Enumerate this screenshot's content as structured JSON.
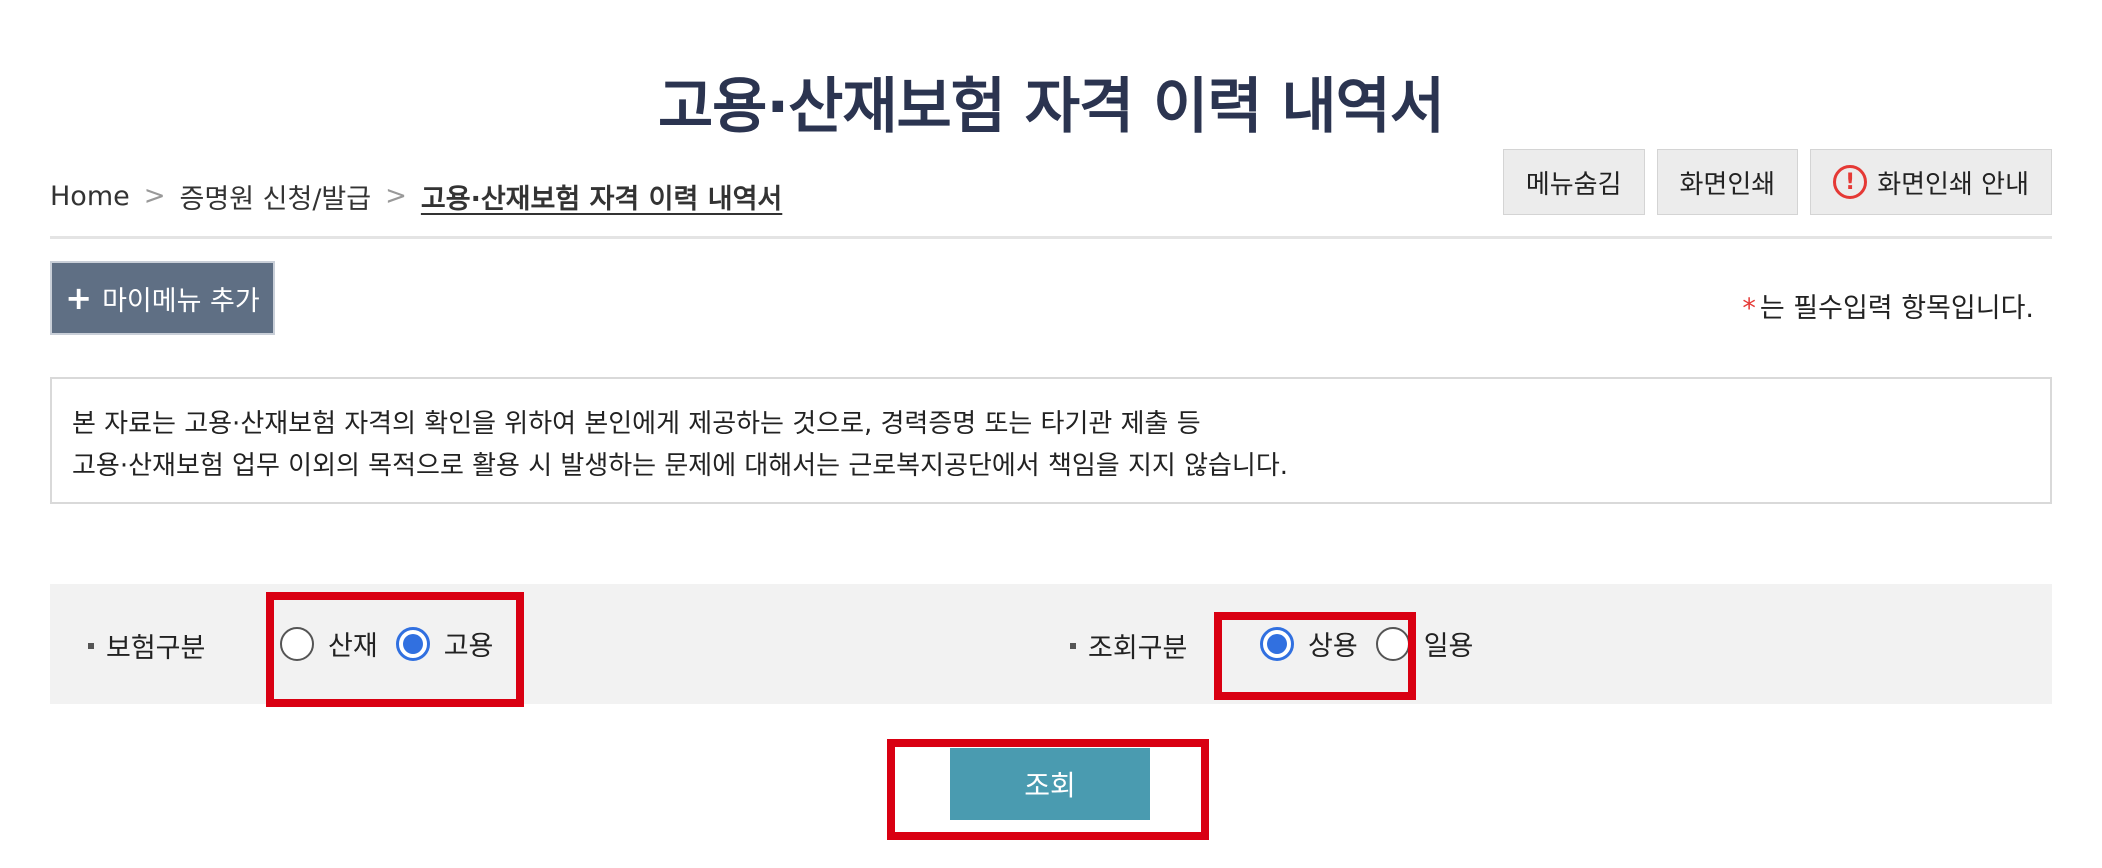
{
  "page": {
    "title": "고용·산재보험 자격 이력 내역서"
  },
  "breadcrumb": {
    "home": "Home",
    "level1": "증명원 신청/발급",
    "current": "고용·산재보험 자격 이력 내역서"
  },
  "toolbar": {
    "hide_menu": "메뉴숨김",
    "print_screen": "화면인쇄",
    "print_guide": "화면인쇄 안내",
    "print_guide_icon": "!"
  },
  "my_menu": {
    "plus": "+",
    "label": "마이메뉴 추가"
  },
  "required_note": {
    "star": "*",
    "text": "는 필수입력 항목입니다."
  },
  "notice": {
    "line1": "본 자료는 고용·산재보험 자격의 확인을 위하여 본인에게 제공하는 것으로, 경력증명 또는 타기관 제출 등",
    "line2": "고용·산재보험 업무 이외의 목적으로 활용 시 발생하는 문제에 대해서는 근로복지공단에서 책임을 지지 않습니다."
  },
  "insurance_type": {
    "label": "보험구분",
    "options": [
      {
        "label": "산재",
        "checked": false
      },
      {
        "label": "고용",
        "checked": true
      }
    ]
  },
  "inquiry_type": {
    "label": "조회구분",
    "options": [
      {
        "label": "상용",
        "checked": true
      },
      {
        "label": "일용",
        "checked": false
      }
    ]
  },
  "search_button": {
    "label": "조회"
  },
  "colors": {
    "title": "#2b3450",
    "highlight": "#d90012",
    "search_button": "#4a9bb0",
    "radio_checked": "#3170e0"
  }
}
